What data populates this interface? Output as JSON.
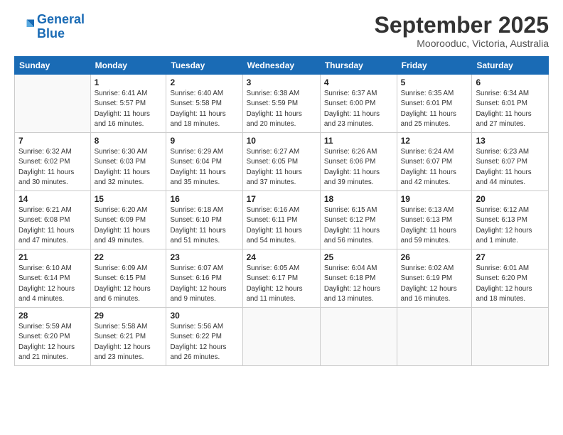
{
  "logo": {
    "line1": "General",
    "line2": "Blue"
  },
  "title": "September 2025",
  "location": "Moorooduc, Victoria, Australia",
  "weekdays": [
    "Sunday",
    "Monday",
    "Tuesday",
    "Wednesday",
    "Thursday",
    "Friday",
    "Saturday"
  ],
  "weeks": [
    [
      {
        "day": "",
        "info": ""
      },
      {
        "day": "1",
        "info": "Sunrise: 6:41 AM\nSunset: 5:57 PM\nDaylight: 11 hours\nand 16 minutes."
      },
      {
        "day": "2",
        "info": "Sunrise: 6:40 AM\nSunset: 5:58 PM\nDaylight: 11 hours\nand 18 minutes."
      },
      {
        "day": "3",
        "info": "Sunrise: 6:38 AM\nSunset: 5:59 PM\nDaylight: 11 hours\nand 20 minutes."
      },
      {
        "day": "4",
        "info": "Sunrise: 6:37 AM\nSunset: 6:00 PM\nDaylight: 11 hours\nand 23 minutes."
      },
      {
        "day": "5",
        "info": "Sunrise: 6:35 AM\nSunset: 6:01 PM\nDaylight: 11 hours\nand 25 minutes."
      },
      {
        "day": "6",
        "info": "Sunrise: 6:34 AM\nSunset: 6:01 PM\nDaylight: 11 hours\nand 27 minutes."
      }
    ],
    [
      {
        "day": "7",
        "info": "Sunrise: 6:32 AM\nSunset: 6:02 PM\nDaylight: 11 hours\nand 30 minutes."
      },
      {
        "day": "8",
        "info": "Sunrise: 6:30 AM\nSunset: 6:03 PM\nDaylight: 11 hours\nand 32 minutes."
      },
      {
        "day": "9",
        "info": "Sunrise: 6:29 AM\nSunset: 6:04 PM\nDaylight: 11 hours\nand 35 minutes."
      },
      {
        "day": "10",
        "info": "Sunrise: 6:27 AM\nSunset: 6:05 PM\nDaylight: 11 hours\nand 37 minutes."
      },
      {
        "day": "11",
        "info": "Sunrise: 6:26 AM\nSunset: 6:06 PM\nDaylight: 11 hours\nand 39 minutes."
      },
      {
        "day": "12",
        "info": "Sunrise: 6:24 AM\nSunset: 6:07 PM\nDaylight: 11 hours\nand 42 minutes."
      },
      {
        "day": "13",
        "info": "Sunrise: 6:23 AM\nSunset: 6:07 PM\nDaylight: 11 hours\nand 44 minutes."
      }
    ],
    [
      {
        "day": "14",
        "info": "Sunrise: 6:21 AM\nSunset: 6:08 PM\nDaylight: 11 hours\nand 47 minutes."
      },
      {
        "day": "15",
        "info": "Sunrise: 6:20 AM\nSunset: 6:09 PM\nDaylight: 11 hours\nand 49 minutes."
      },
      {
        "day": "16",
        "info": "Sunrise: 6:18 AM\nSunset: 6:10 PM\nDaylight: 11 hours\nand 51 minutes."
      },
      {
        "day": "17",
        "info": "Sunrise: 6:16 AM\nSunset: 6:11 PM\nDaylight: 11 hours\nand 54 minutes."
      },
      {
        "day": "18",
        "info": "Sunrise: 6:15 AM\nSunset: 6:12 PM\nDaylight: 11 hours\nand 56 minutes."
      },
      {
        "day": "19",
        "info": "Sunrise: 6:13 AM\nSunset: 6:13 PM\nDaylight: 11 hours\nand 59 minutes."
      },
      {
        "day": "20",
        "info": "Sunrise: 6:12 AM\nSunset: 6:13 PM\nDaylight: 12 hours\nand 1 minute."
      }
    ],
    [
      {
        "day": "21",
        "info": "Sunrise: 6:10 AM\nSunset: 6:14 PM\nDaylight: 12 hours\nand 4 minutes."
      },
      {
        "day": "22",
        "info": "Sunrise: 6:09 AM\nSunset: 6:15 PM\nDaylight: 12 hours\nand 6 minutes."
      },
      {
        "day": "23",
        "info": "Sunrise: 6:07 AM\nSunset: 6:16 PM\nDaylight: 12 hours\nand 9 minutes."
      },
      {
        "day": "24",
        "info": "Sunrise: 6:05 AM\nSunset: 6:17 PM\nDaylight: 12 hours\nand 11 minutes."
      },
      {
        "day": "25",
        "info": "Sunrise: 6:04 AM\nSunset: 6:18 PM\nDaylight: 12 hours\nand 13 minutes."
      },
      {
        "day": "26",
        "info": "Sunrise: 6:02 AM\nSunset: 6:19 PM\nDaylight: 12 hours\nand 16 minutes."
      },
      {
        "day": "27",
        "info": "Sunrise: 6:01 AM\nSunset: 6:20 PM\nDaylight: 12 hours\nand 18 minutes."
      }
    ],
    [
      {
        "day": "28",
        "info": "Sunrise: 5:59 AM\nSunset: 6:20 PM\nDaylight: 12 hours\nand 21 minutes."
      },
      {
        "day": "29",
        "info": "Sunrise: 5:58 AM\nSunset: 6:21 PM\nDaylight: 12 hours\nand 23 minutes."
      },
      {
        "day": "30",
        "info": "Sunrise: 5:56 AM\nSunset: 6:22 PM\nDaylight: 12 hours\nand 26 minutes."
      },
      {
        "day": "",
        "info": ""
      },
      {
        "day": "",
        "info": ""
      },
      {
        "day": "",
        "info": ""
      },
      {
        "day": "",
        "info": ""
      }
    ]
  ]
}
